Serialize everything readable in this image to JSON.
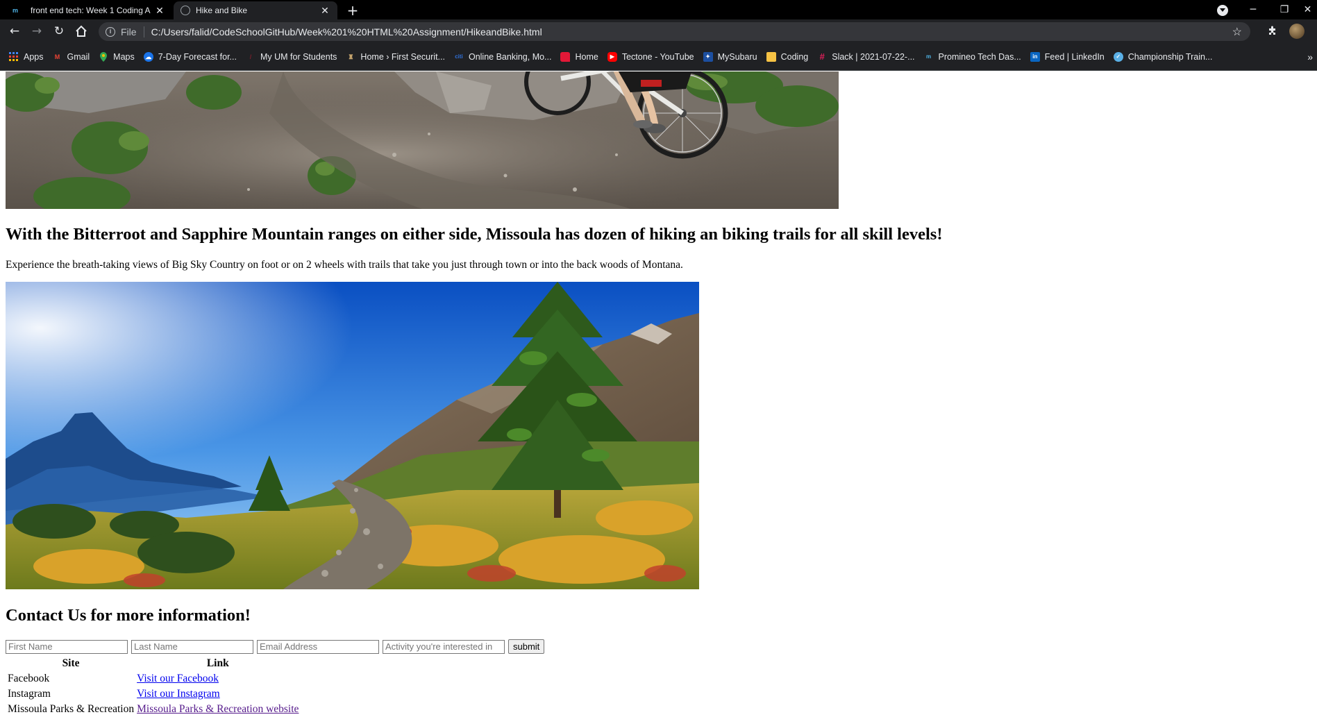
{
  "browser": {
    "tabs": [
      {
        "title": "front end tech: Week 1 Coding A",
        "favicon": "promineo-favicon",
        "active": false
      },
      {
        "title": "Hike and Bike",
        "favicon": "globe-icon",
        "active": true
      }
    ],
    "new_tab": "+",
    "window_controls": {
      "minimize": "─",
      "restore": "❐",
      "close": "✕"
    },
    "address": {
      "scheme_label": "File",
      "url": "C:/Users/falid/CodeSchoolGitHub/Week%201%20HTML%20Assignment/HikeandBike.html"
    },
    "bookmarks": [
      {
        "label": "Apps",
        "icon": "apps-grid-icon",
        "color": "#4285f4"
      },
      {
        "label": "Gmail",
        "icon": "gmail-icon",
        "color": "#ea4335"
      },
      {
        "label": "Maps",
        "icon": "maps-pin-icon",
        "color": "#34a853"
      },
      {
        "label": "7-Day Forecast for...",
        "icon": "weather-icon",
        "color": "#1a73e8"
      },
      {
        "label": "My UM for Students",
        "icon": "um-icon",
        "color": "#7a1f2b"
      },
      {
        "label": "Home › First Securit...",
        "icon": "bank-icon",
        "color": "#c5a46d"
      },
      {
        "label": "Online Banking, Mo...",
        "icon": "citi-icon",
        "color": "#2f6fd6"
      },
      {
        "label": "Home",
        "icon": "home-red-icon",
        "color": "#e31837"
      },
      {
        "label": "Tectone - YouTube",
        "icon": "youtube-icon",
        "color": "#ff0000"
      },
      {
        "label": "MySubaru",
        "icon": "subaru-icon",
        "color": "#1c4fa0"
      },
      {
        "label": "Coding",
        "icon": "folder-icon",
        "color": "#f6c244"
      },
      {
        "label": "Slack | 2021-07-22-...",
        "icon": "slack-icon",
        "color": "#e01e5a"
      },
      {
        "label": "Promineo Tech Das...",
        "icon": "promineo-icon",
        "color": "#4fb5e8"
      },
      {
        "label": "Feed | LinkedIn",
        "icon": "linkedin-icon",
        "color": "#0a66c2"
      },
      {
        "label": "Championship Train...",
        "icon": "championship-icon",
        "color": "#5ab0e6"
      }
    ],
    "bookmarks_overflow": "»"
  },
  "page": {
    "headline": "With the Bitterroot and Sapphire Mountain ranges on either side, Missoula has dozen of hiking an biking trails for all skill levels!",
    "intro": "Experience the breath-taking views of Big Sky Country on foot or on 2 wheels with trails that take you just through town or into the back woods of Montana.",
    "contact_heading": "Contact Us for more information!",
    "form": {
      "first_name_placeholder": "First Name",
      "last_name_placeholder": "Last Name",
      "email_placeholder": "Email Address",
      "activity_placeholder": "Activity you're interested in",
      "submit_label": "submit"
    },
    "links_table": {
      "headers": [
        "Site",
        "Link"
      ],
      "rows": [
        {
          "site": "Facebook",
          "link": "Visit our Facebook"
        },
        {
          "site": "Instagram",
          "link": "Visit our Instagram"
        },
        {
          "site": "Missoula Parks & Recreation",
          "link": "Missoula Parks & Recreation website"
        }
      ]
    }
  }
}
